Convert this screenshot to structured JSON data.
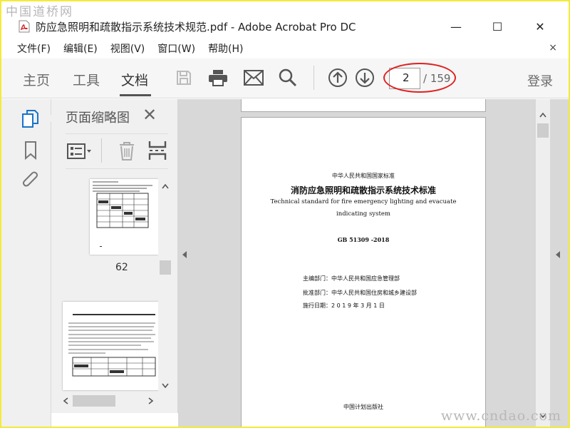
{
  "watermarks": {
    "top": "中国道桥网",
    "bottom": "www.cndao.com"
  },
  "window": {
    "title": "防应急照明和疏散指示系统技术规范.pdf - Adobe Acrobat Pro DC",
    "buttons": {
      "minimize": "—",
      "maximize": "☐",
      "close": "✕"
    }
  },
  "menu": {
    "items": [
      "文件(F)",
      "编辑(E)",
      "视图(V)",
      "窗口(W)",
      "帮助(H)"
    ],
    "close_doc": "×"
  },
  "toolbar": {
    "tabs": [
      "主页",
      "工具",
      "文档"
    ],
    "active_tab": "文档",
    "icons": [
      "save-icon",
      "print-icon",
      "email-icon",
      "search-icon",
      "page-up-icon",
      "page-down-icon"
    ],
    "current_page": "2",
    "total_pages": "/ 159",
    "login": "登录",
    "highlight_color": "#e02020"
  },
  "rail": {
    "icons": [
      "page-thumbnails-icon",
      "bookmark-icon",
      "attachment-icon"
    ]
  },
  "thumbnail_panel": {
    "title": "页面缩略图",
    "close": "✕",
    "tools": [
      "options-menu-icon",
      "delete-icon",
      "crop-icon"
    ],
    "thumbnails": [
      {
        "label": "62"
      }
    ]
  },
  "document": {
    "page_lines": {
      "header": "中华人民共和国国家标准",
      "title": "消防应急照明和疏散指示系统技术标准",
      "english_1": "Technical standard for fire emergency lighting and evacuate",
      "english_2": "indicating system",
      "code": "GB 51309 -2018",
      "editor": "主编部门：中华人民共和国应急管理部",
      "approver": "批准部门：中华人民共和国住房和城乡建设部",
      "date": "施行日期：2 0 1 9 年  3 月  1 日",
      "publisher": "中国计划出版社"
    }
  }
}
